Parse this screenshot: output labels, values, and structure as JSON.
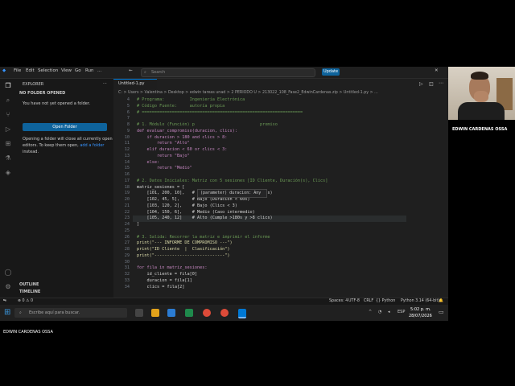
{
  "menu": [
    "File",
    "Edit",
    "Selection",
    "View",
    "Go",
    "Run",
    "..."
  ],
  "search_placeholder": "Search",
  "update_label": "Update",
  "explorer": {
    "title": "EXPLORER",
    "section": "NO FOLDER OPENED",
    "not_opened": "You have not yet opened a folder.",
    "open_folder_button": "Open Folder",
    "info_line1": "Opening a folder will close all currently open",
    "info_line2_prefix": "editors. To keep them open,",
    "info_link": "add a folder",
    "info_line3": "instead.",
    "outline": "OUTLINE",
    "timeline": "TIMELINE"
  },
  "tab_label": "Untitled-1.py",
  "breadcrumb": "C: > Users > Valentina > Desktop > edwin tareas unad > 2 PERIODO U > 213022_108_Fase2_EdwinCardenas.zip > Untitled-1.py > ...",
  "tooltip": "(parameter) duracion: Any",
  "code_lines": [
    {
      "n": "4",
      "t": "# Programa:          Ingeniería Electrónica"
    },
    {
      "n": "5",
      "t": "# Código Fuente:     autoría propia"
    },
    {
      "n": "6",
      "t": "# ================================================================"
    },
    {
      "n": "7",
      "t": ""
    },
    {
      "n": "8",
      "t": "# 1. Módulo (Función) p                          promiso"
    },
    {
      "n": "9",
      "t": "def evaluar_compromiso(duracion, clics):"
    },
    {
      "n": "10",
      "t": "    if duracion > 180 and clics > 8:"
    },
    {
      "n": "11",
      "t": "        return \"Alto\""
    },
    {
      "n": "12",
      "t": "    elif duracion < 60 or clics < 3:"
    },
    {
      "n": "13",
      "t": "        return \"Bajo\""
    },
    {
      "n": "14",
      "t": "    else:"
    },
    {
      "n": "15",
      "t": "        return \"Medio\""
    },
    {
      "n": "16",
      "t": ""
    },
    {
      "n": "17",
      "t": "# 2. Datos Iniciales: Matriz con 5 sesiones [ID Cliente, Duración(s), Clics]"
    },
    {
      "n": "18",
      "t": "matriz_sesiones = ["
    },
    {
      "n": "19",
      "t": "    [101, 200, 10],   # Alto (Cumple >180s y >8 clics)"
    },
    {
      "n": "20",
      "t": "    [102, 45, 5],     # Bajo (Duración < 60s)"
    },
    {
      "n": "21",
      "t": "    [103, 120, 2],    # Bajo (Clics < 3)"
    },
    {
      "n": "22",
      "t": "    [104, 150, 6],    # Medio (Caso intermedio)"
    },
    {
      "n": "23",
      "t": "    [105, 240, 12]    # Alto (Cumple >180s y >8 clics)"
    },
    {
      "n": "24",
      "t": "]"
    },
    {
      "n": "25",
      "t": ""
    },
    {
      "n": "26",
      "t": "# 3. Salida: Recorrer la matriz e imprimir el informe"
    },
    {
      "n": "27",
      "t": "print(\"--- INFORME DE COMPROMISO ---\")"
    },
    {
      "n": "28",
      "t": "print(\"ID Cliente  |  Clasificación\")"
    },
    {
      "n": "29",
      "t": "print(\"----------------------------\")"
    },
    {
      "n": "30",
      "t": ""
    },
    {
      "n": "31",
      "t": "for fila in matriz_sesiones:"
    },
    {
      "n": "32",
      "t": "    id_cliente = fila[0]"
    },
    {
      "n": "33",
      "t": "    duracion = fila[1]"
    },
    {
      "n": "34",
      "t": "    clics = fila[2]"
    }
  ],
  "status": {
    "errors": "⊗ 0 ⚠ 0",
    "spaces": "Spaces: 4",
    "encoding": "UTF-8",
    "eol": "CRLF",
    "language": "{} Python",
    "interpreter": "Python 3.14 (64-bit)"
  },
  "taskbar": {
    "search_placeholder": "Escribe aquí para buscar.",
    "lang": "ESP",
    "time": "5:02 p. m.",
    "date": "28/07/2026"
  },
  "webcam_name": "EDWIN CARDENAS OSSA",
  "bottom_name": "EDWIN CARDENAS OSSA"
}
